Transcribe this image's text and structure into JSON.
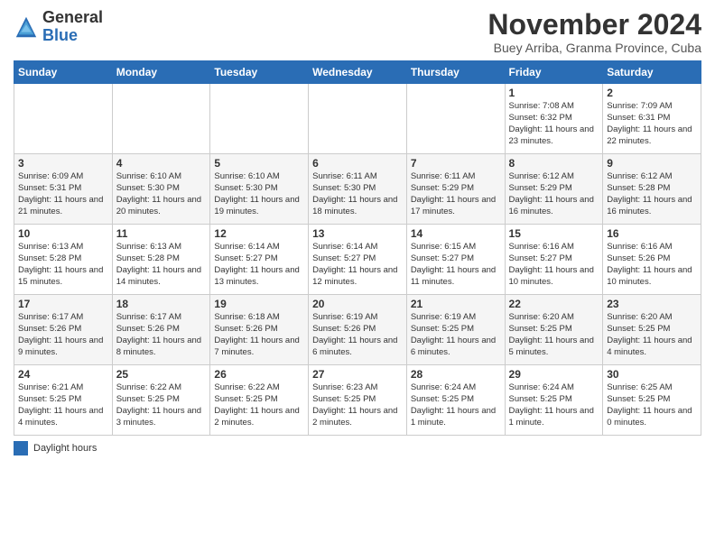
{
  "logo": {
    "general": "General",
    "blue": "Blue"
  },
  "title": "November 2024",
  "subtitle": "Buey Arriba, Granma Province, Cuba",
  "days_of_week": [
    "Sunday",
    "Monday",
    "Tuesday",
    "Wednesday",
    "Thursday",
    "Friday",
    "Saturday"
  ],
  "weeks": [
    [
      {
        "day": "",
        "text": ""
      },
      {
        "day": "",
        "text": ""
      },
      {
        "day": "",
        "text": ""
      },
      {
        "day": "",
        "text": ""
      },
      {
        "day": "",
        "text": ""
      },
      {
        "day": "1",
        "text": "Sunrise: 7:08 AM\nSunset: 6:32 PM\nDaylight: 11 hours and 23 minutes."
      },
      {
        "day": "2",
        "text": "Sunrise: 7:09 AM\nSunset: 6:31 PM\nDaylight: 11 hours and 22 minutes."
      }
    ],
    [
      {
        "day": "3",
        "text": "Sunrise: 6:09 AM\nSunset: 5:31 PM\nDaylight: 11 hours and 21 minutes."
      },
      {
        "day": "4",
        "text": "Sunrise: 6:10 AM\nSunset: 5:30 PM\nDaylight: 11 hours and 20 minutes."
      },
      {
        "day": "5",
        "text": "Sunrise: 6:10 AM\nSunset: 5:30 PM\nDaylight: 11 hours and 19 minutes."
      },
      {
        "day": "6",
        "text": "Sunrise: 6:11 AM\nSunset: 5:30 PM\nDaylight: 11 hours and 18 minutes."
      },
      {
        "day": "7",
        "text": "Sunrise: 6:11 AM\nSunset: 5:29 PM\nDaylight: 11 hours and 17 minutes."
      },
      {
        "day": "8",
        "text": "Sunrise: 6:12 AM\nSunset: 5:29 PM\nDaylight: 11 hours and 16 minutes."
      },
      {
        "day": "9",
        "text": "Sunrise: 6:12 AM\nSunset: 5:28 PM\nDaylight: 11 hours and 16 minutes."
      }
    ],
    [
      {
        "day": "10",
        "text": "Sunrise: 6:13 AM\nSunset: 5:28 PM\nDaylight: 11 hours and 15 minutes."
      },
      {
        "day": "11",
        "text": "Sunrise: 6:13 AM\nSunset: 5:28 PM\nDaylight: 11 hours and 14 minutes."
      },
      {
        "day": "12",
        "text": "Sunrise: 6:14 AM\nSunset: 5:27 PM\nDaylight: 11 hours and 13 minutes."
      },
      {
        "day": "13",
        "text": "Sunrise: 6:14 AM\nSunset: 5:27 PM\nDaylight: 11 hours and 12 minutes."
      },
      {
        "day": "14",
        "text": "Sunrise: 6:15 AM\nSunset: 5:27 PM\nDaylight: 11 hours and 11 minutes."
      },
      {
        "day": "15",
        "text": "Sunrise: 6:16 AM\nSunset: 5:27 PM\nDaylight: 11 hours and 10 minutes."
      },
      {
        "day": "16",
        "text": "Sunrise: 6:16 AM\nSunset: 5:26 PM\nDaylight: 11 hours and 10 minutes."
      }
    ],
    [
      {
        "day": "17",
        "text": "Sunrise: 6:17 AM\nSunset: 5:26 PM\nDaylight: 11 hours and 9 minutes."
      },
      {
        "day": "18",
        "text": "Sunrise: 6:17 AM\nSunset: 5:26 PM\nDaylight: 11 hours and 8 minutes."
      },
      {
        "day": "19",
        "text": "Sunrise: 6:18 AM\nSunset: 5:26 PM\nDaylight: 11 hours and 7 minutes."
      },
      {
        "day": "20",
        "text": "Sunrise: 6:19 AM\nSunset: 5:26 PM\nDaylight: 11 hours and 6 minutes."
      },
      {
        "day": "21",
        "text": "Sunrise: 6:19 AM\nSunset: 5:25 PM\nDaylight: 11 hours and 6 minutes."
      },
      {
        "day": "22",
        "text": "Sunrise: 6:20 AM\nSunset: 5:25 PM\nDaylight: 11 hours and 5 minutes."
      },
      {
        "day": "23",
        "text": "Sunrise: 6:20 AM\nSunset: 5:25 PM\nDaylight: 11 hours and 4 minutes."
      }
    ],
    [
      {
        "day": "24",
        "text": "Sunrise: 6:21 AM\nSunset: 5:25 PM\nDaylight: 11 hours and 4 minutes."
      },
      {
        "day": "25",
        "text": "Sunrise: 6:22 AM\nSunset: 5:25 PM\nDaylight: 11 hours and 3 minutes."
      },
      {
        "day": "26",
        "text": "Sunrise: 6:22 AM\nSunset: 5:25 PM\nDaylight: 11 hours and 2 minutes."
      },
      {
        "day": "27",
        "text": "Sunrise: 6:23 AM\nSunset: 5:25 PM\nDaylight: 11 hours and 2 minutes."
      },
      {
        "day": "28",
        "text": "Sunrise: 6:24 AM\nSunset: 5:25 PM\nDaylight: 11 hours and 1 minute."
      },
      {
        "day": "29",
        "text": "Sunrise: 6:24 AM\nSunset: 5:25 PM\nDaylight: 11 hours and 1 minute."
      },
      {
        "day": "30",
        "text": "Sunrise: 6:25 AM\nSunset: 5:25 PM\nDaylight: 11 hours and 0 minutes."
      }
    ]
  ],
  "footer": {
    "daylight_label": "Daylight hours"
  }
}
